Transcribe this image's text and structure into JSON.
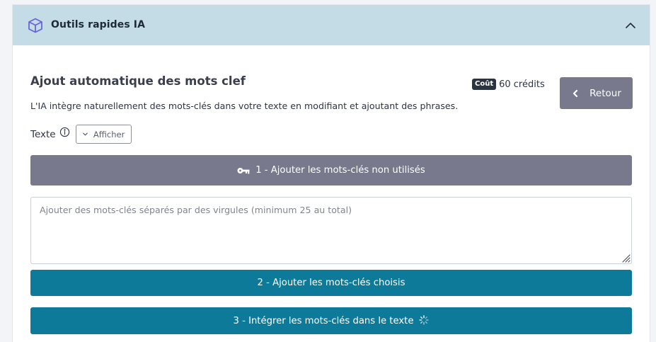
{
  "header": {
    "title": "Outils rapides IA",
    "icon": "cube-icon",
    "collapse_icon": "chevron-up-icon"
  },
  "section": {
    "title": "Ajout automatique des mots clef",
    "description": "L'IA intègre naturellement des mots-clés dans votre texte en modifiant et ajoutant des phrases."
  },
  "cost": {
    "badge": "Coût",
    "amount": "60 crédits"
  },
  "back_button": {
    "label": "Retour",
    "icon": "chevron-left-icon"
  },
  "texte": {
    "label": "Texte",
    "info_icon": "info-circle-icon",
    "afficher_label": "Afficher"
  },
  "steps": {
    "step1_label": "1 - Ajouter les mots-clés non utilisés",
    "step2_label": "2 - Ajouter les mots-clés choisis",
    "step3_label": "3 - Intégrer les mots-clés dans le texte"
  },
  "keywords_input": {
    "placeholder": "Ajouter des mots-clés séparés par des virgules (minimum 25 au total)",
    "value": ""
  },
  "colors": {
    "header_bg": "#c3dce6",
    "accent_teal": "#0e7a99",
    "muted_button": "#79798d",
    "icon_purple": "#6b63d9"
  }
}
